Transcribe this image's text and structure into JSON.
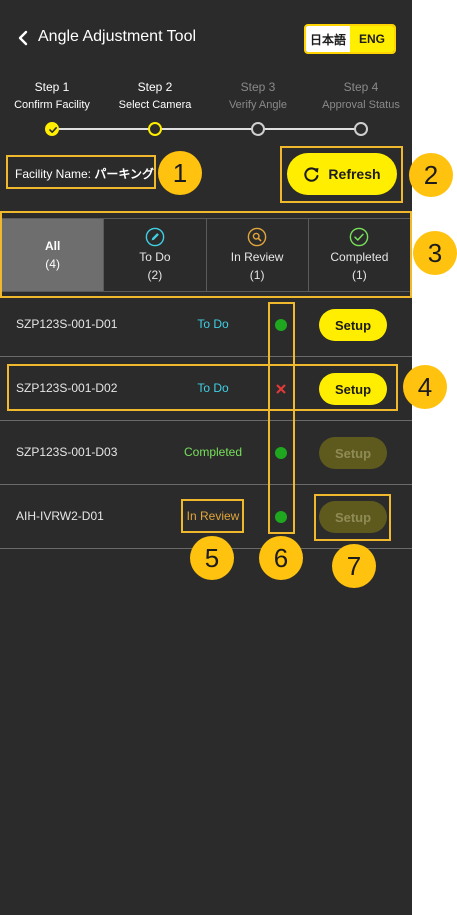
{
  "header": {
    "title": "Angle Adjustment Tool",
    "lang_ja": "日本語",
    "lang_en": "ENG"
  },
  "stepper": {
    "steps": [
      {
        "title": "Step 1",
        "subtitle": "Confirm Facility",
        "state": "done"
      },
      {
        "title": "Step 2",
        "subtitle": "Select Camera",
        "state": "current"
      },
      {
        "title": "Step 3",
        "subtitle": "Verify Angle",
        "state": "pending"
      },
      {
        "title": "Step 4",
        "subtitle": "Approval Status",
        "state": "pending"
      }
    ]
  },
  "facility": {
    "label": "Facility Name:",
    "value": "パーキング"
  },
  "refresh": {
    "label": "Refresh"
  },
  "tabs": [
    {
      "label": "All",
      "count": "(4)",
      "icon": "none",
      "selected": true
    },
    {
      "label": "To Do",
      "count": "(2)",
      "icon": "pencil-icon",
      "selected": false
    },
    {
      "label": "In Review",
      "count": "(1)",
      "icon": "search-icon",
      "selected": false
    },
    {
      "label": "Completed",
      "count": "(1)",
      "icon": "check-circle-icon",
      "selected": false
    }
  ],
  "cameras": [
    {
      "name": "SZP123S-001-D01",
      "status": "To Do",
      "indicator": "ok",
      "setup_label": "Setup",
      "setup_enabled": true
    },
    {
      "name": "SZP123S-001-D02",
      "status": "To Do",
      "indicator": "error",
      "setup_label": "Setup",
      "setup_enabled": true
    },
    {
      "name": "SZP123S-001-D03",
      "status": "Completed",
      "indicator": "ok",
      "setup_label": "Setup",
      "setup_enabled": false
    },
    {
      "name": "AIH-IVRW2-D01",
      "status": "In Review",
      "indicator": "ok",
      "setup_label": "Setup",
      "setup_enabled": false
    }
  ],
  "annotations": [
    "1",
    "2",
    "3",
    "4",
    "5",
    "6",
    "7"
  ],
  "colors": {
    "background": "#2b2b2b",
    "accent": "#ffee00",
    "annotation": "#ffc20e",
    "todo": "#3fd0e4",
    "completed": "#76e05a",
    "review": "#e0a53b",
    "ok_indicator": "#1fa81f",
    "error_indicator": "#e53935"
  }
}
